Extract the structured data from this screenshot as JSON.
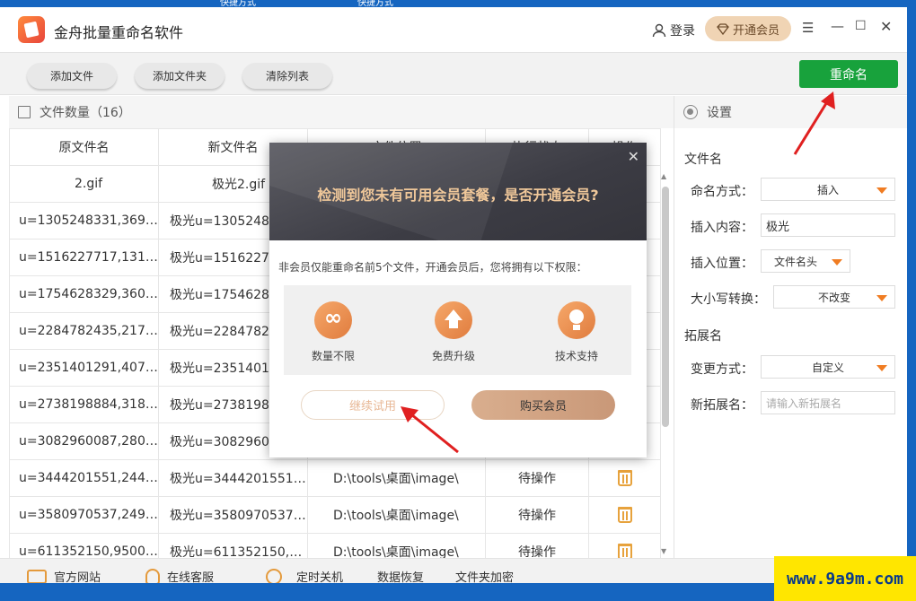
{
  "app": {
    "title": "金舟批量重命名软件",
    "login": "登录",
    "vip": "开通会员"
  },
  "toolbar": {
    "add_file": "添加文件",
    "add_folder": "添加文件夹",
    "clear_list": "清除列表",
    "rename": "重命名"
  },
  "files": {
    "count_label": "文件数量（16）",
    "columns": [
      "原文件名",
      "新文件名",
      "文件位置",
      "执行状态",
      "操作"
    ],
    "rows": [
      {
        "orig": "2.gif",
        "new": "极光2.gif",
        "path": "",
        "status": ""
      },
      {
        "orig": "u=1305248331,3698...",
        "new": "极光u=1305248331,...",
        "path": "",
        "status": ""
      },
      {
        "orig": "u=1516227717,1318...",
        "new": "极光u=1516227717,...",
        "path": "",
        "status": ""
      },
      {
        "orig": "u=1754628329,3609...",
        "new": "极光u=1754628329,...",
        "path": "",
        "status": ""
      },
      {
        "orig": "u=2284782435,2170...",
        "new": "极光u=2284782435,...",
        "path": "",
        "status": ""
      },
      {
        "orig": "u=2351401291,4078...",
        "new": "极光u=2351401291,...",
        "path": "",
        "status": ""
      },
      {
        "orig": "u=2738198884,3183...",
        "new": "极光u=2738198884,...",
        "path": "",
        "status": ""
      },
      {
        "orig": "u=3082960087,2804...",
        "new": "极光u=3082960087,...",
        "path": "",
        "status": ""
      },
      {
        "orig": "u=3444201551,2442...",
        "new": "极光u=3444201551,...",
        "path": "D:\\tools\\桌面\\image\\",
        "status": "待操作"
      },
      {
        "orig": "u=3580970537,2497...",
        "new": "极光u=3580970537,...",
        "path": "D:\\tools\\桌面\\image\\",
        "status": "待操作"
      },
      {
        "orig": "u=611352150,95003...",
        "new": "极光u=611352150,9...",
        "path": "D:\\tools\\桌面\\image\\",
        "status": "待操作"
      }
    ]
  },
  "settings": {
    "header": "设置",
    "filename_section": "文件名",
    "naming_label": "命名方式：",
    "naming_value": "插入",
    "insert_content_label": "插入内容：",
    "insert_content_value": "极光",
    "insert_pos_label": "插入位置：",
    "insert_pos_value": "文件名头",
    "case_label": "大小写转换：",
    "case_value": "不改变",
    "ext_section": "拓展名",
    "change_label": "变更方式：",
    "change_value": "自定义",
    "new_ext_label": "新拓展名：",
    "new_ext_placeholder": "请输入新拓展名"
  },
  "bottom": {
    "website": "官方网站",
    "service": "在线客服",
    "shutdown": "定时关机",
    "recovery": "数据恢复",
    "encrypt": "文件夹加密"
  },
  "dialog": {
    "title": "检测到您未有可用会员套餐，是否开通会员?",
    "desc": "非会员仅能重命名前5个文件，开通会员后，您将拥有以下权限：",
    "benefits": [
      "数量不限",
      "免费升级",
      "技术支持"
    ],
    "trial": "继续试用",
    "buy": "购买会员"
  },
  "topstrip": {
    "left": "快捷方式",
    "right": "快捷方式"
  },
  "watermark": "www.9a9m.com",
  "colors": {
    "rename_green": "#18a23c",
    "accent_orange": "#f07c22",
    "vip_gold": "#f0d4b4",
    "arrow_red": "#e02020"
  }
}
